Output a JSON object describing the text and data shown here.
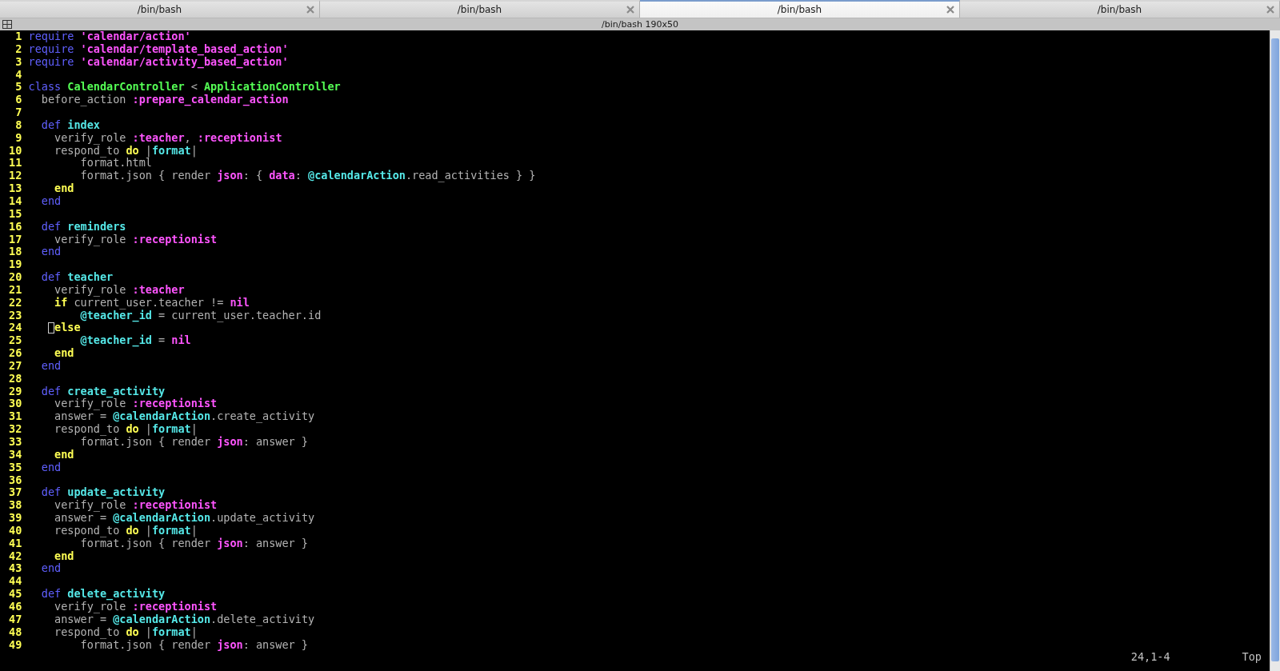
{
  "tabs": [
    {
      "label": "/bin/bash",
      "selected": false
    },
    {
      "label": "/bin/bash",
      "selected": false
    },
    {
      "label": "/bin/bash",
      "selected": true
    },
    {
      "label": "/bin/bash",
      "selected": false
    }
  ],
  "title_bar": {
    "title": "/bin/bash 190x50"
  },
  "editor": {
    "lines": [
      {
        "number": "1",
        "cursor": false,
        "segments": [
          {
            "kind": "keyword",
            "text": "require"
          },
          {
            "kind": "string",
            "text": " 'calendar/action'"
          }
        ]
      },
      {
        "number": "2",
        "cursor": false,
        "segments": [
          {
            "kind": "keyword",
            "text": "require"
          },
          {
            "kind": "string",
            "text": " 'calendar/template_based_action'"
          }
        ]
      },
      {
        "number": "3",
        "cursor": false,
        "segments": [
          {
            "kind": "keyword",
            "text": "require"
          },
          {
            "kind": "string",
            "text": " 'calendar/activity_based_action'"
          }
        ]
      },
      {
        "number": "4",
        "cursor": false
      },
      {
        "number": "5",
        "cursor": false,
        "segments": [
          {
            "kind": "keyword",
            "text": "class"
          },
          {
            "kind": "constant",
            "text": " CalendarController"
          },
          {
            "kind": "plain",
            "text": " < "
          },
          {
            "kind": "constant",
            "text": "ApplicationController"
          }
        ]
      },
      {
        "number": "6",
        "cursor": false,
        "segments": [
          {
            "kind": "plain",
            "text": "  before_action "
          },
          {
            "kind": "symbol",
            "text": ":prepare_calendar_action"
          }
        ]
      },
      {
        "number": "7",
        "cursor": false
      },
      {
        "number": "8",
        "cursor": false,
        "segments": [
          {
            "kind": "keyword",
            "text": "  def"
          },
          {
            "kind": "name",
            "text": " index"
          }
        ]
      },
      {
        "number": "9",
        "cursor": false,
        "segments": [
          {
            "kind": "plain",
            "text": "    verify_role "
          },
          {
            "kind": "symbol",
            "text": ":teacher"
          },
          {
            "kind": "plain",
            "text": ", "
          },
          {
            "kind": "symbol",
            "text": ":receptionist"
          }
        ]
      },
      {
        "number": "10",
        "cursor": false,
        "segments": [
          {
            "kind": "plain",
            "text": "    respond_to "
          },
          {
            "kind": "control",
            "text": "do"
          },
          {
            "kind": "plain",
            "text": " |"
          },
          {
            "kind": "name",
            "text": "format"
          },
          {
            "kind": "plain",
            "text": "|"
          }
        ]
      },
      {
        "number": "11",
        "cursor": false,
        "segments": [
          {
            "kind": "plain",
            "text": "        format.html"
          }
        ]
      },
      {
        "number": "12",
        "cursor": false,
        "segments": [
          {
            "kind": "plain",
            "text": "        format.json { render "
          },
          {
            "kind": "symbol",
            "text": "json"
          },
          {
            "kind": "plain",
            "text": ": { "
          },
          {
            "kind": "symbol",
            "text": "data"
          },
          {
            "kind": "plain",
            "text": ": "
          },
          {
            "kind": "name",
            "text": "@calendarAction"
          },
          {
            "kind": "plain",
            "text": ".read_activities } }"
          }
        ]
      },
      {
        "number": "13",
        "cursor": false,
        "segments": [
          {
            "kind": "control",
            "text": "    end"
          }
        ]
      },
      {
        "number": "14",
        "cursor": false,
        "segments": [
          {
            "kind": "keyword",
            "text": "  end"
          }
        ]
      },
      {
        "number": "15",
        "cursor": false
      },
      {
        "number": "16",
        "cursor": false,
        "segments": [
          {
            "kind": "keyword",
            "text": "  def"
          },
          {
            "kind": "name",
            "text": " reminders"
          }
        ]
      },
      {
        "number": "17",
        "cursor": false,
        "segments": [
          {
            "kind": "plain",
            "text": "    verify_role "
          },
          {
            "kind": "symbol",
            "text": ":receptionist"
          }
        ]
      },
      {
        "number": "18",
        "cursor": false,
        "segments": [
          {
            "kind": "keyword",
            "text": "  end"
          }
        ]
      },
      {
        "number": "19",
        "cursor": false
      },
      {
        "number": "20",
        "cursor": false,
        "segments": [
          {
            "kind": "keyword",
            "text": "  def"
          },
          {
            "kind": "name",
            "text": " teacher"
          }
        ]
      },
      {
        "number": "21",
        "cursor": false,
        "segments": [
          {
            "kind": "plain",
            "text": "    verify_role "
          },
          {
            "kind": "symbol",
            "text": ":teacher"
          }
        ]
      },
      {
        "number": "22",
        "cursor": false,
        "segments": [
          {
            "kind": "control",
            "text": "    if"
          },
          {
            "kind": "plain",
            "text": " current_user.teacher != "
          },
          {
            "kind": "symbol",
            "text": "nil"
          }
        ]
      },
      {
        "number": "23",
        "cursor": false,
        "segments": [
          {
            "kind": "name",
            "text": "        @teacher_id"
          },
          {
            "kind": "plain",
            "text": " = current_user.teacher.id"
          }
        ]
      },
      {
        "number": "24",
        "cursor": true,
        "segments": [
          {
            "kind": "control",
            "text": "    else"
          }
        ]
      },
      {
        "number": "25",
        "cursor": false,
        "segments": [
          {
            "kind": "name",
            "text": "        @teacher_id"
          },
          {
            "kind": "plain",
            "text": " = "
          },
          {
            "kind": "symbol",
            "text": "nil"
          }
        ]
      },
      {
        "number": "26",
        "cursor": false,
        "segments": [
          {
            "kind": "control",
            "text": "    end"
          }
        ]
      },
      {
        "number": "27",
        "cursor": false,
        "segments": [
          {
            "kind": "keyword",
            "text": "  end"
          }
        ]
      },
      {
        "number": "28",
        "cursor": false
      },
      {
        "number": "29",
        "cursor": false,
        "segments": [
          {
            "kind": "keyword",
            "text": "  def"
          },
          {
            "kind": "name",
            "text": " create_activity"
          }
        ]
      },
      {
        "number": "30",
        "cursor": false,
        "segments": [
          {
            "kind": "plain",
            "text": "    verify_role "
          },
          {
            "kind": "symbol",
            "text": ":receptionist"
          }
        ]
      },
      {
        "number": "31",
        "cursor": false,
        "segments": [
          {
            "kind": "plain",
            "text": "    answer = "
          },
          {
            "kind": "name",
            "text": "@calendarAction"
          },
          {
            "kind": "plain",
            "text": ".create_activity"
          }
        ]
      },
      {
        "number": "32",
        "cursor": false,
        "segments": [
          {
            "kind": "plain",
            "text": "    respond_to "
          },
          {
            "kind": "control",
            "text": "do"
          },
          {
            "kind": "plain",
            "text": " |"
          },
          {
            "kind": "name",
            "text": "format"
          },
          {
            "kind": "plain",
            "text": "|"
          }
        ]
      },
      {
        "number": "33",
        "cursor": false,
        "segments": [
          {
            "kind": "plain",
            "text": "        format.json { render "
          },
          {
            "kind": "symbol",
            "text": "json"
          },
          {
            "kind": "plain",
            "text": ": answer }"
          }
        ]
      },
      {
        "number": "34",
        "cursor": false,
        "segments": [
          {
            "kind": "control",
            "text": "    end"
          }
        ]
      },
      {
        "number": "35",
        "cursor": false,
        "segments": [
          {
            "kind": "keyword",
            "text": "  end"
          }
        ]
      },
      {
        "number": "36",
        "cursor": false
      },
      {
        "number": "37",
        "cursor": false,
        "segments": [
          {
            "kind": "keyword",
            "text": "  def"
          },
          {
            "kind": "name",
            "text": " update_activity"
          }
        ]
      },
      {
        "number": "38",
        "cursor": false,
        "segments": [
          {
            "kind": "plain",
            "text": "    verify_role "
          },
          {
            "kind": "symbol",
            "text": ":receptionist"
          }
        ]
      },
      {
        "number": "39",
        "cursor": false,
        "segments": [
          {
            "kind": "plain",
            "text": "    answer = "
          },
          {
            "kind": "name",
            "text": "@calendarAction"
          },
          {
            "kind": "plain",
            "text": ".update_activity"
          }
        ]
      },
      {
        "number": "40",
        "cursor": false,
        "segments": [
          {
            "kind": "plain",
            "text": "    respond_to "
          },
          {
            "kind": "control",
            "text": "do"
          },
          {
            "kind": "plain",
            "text": " |"
          },
          {
            "kind": "name",
            "text": "format"
          },
          {
            "kind": "plain",
            "text": "|"
          }
        ]
      },
      {
        "number": "41",
        "cursor": false,
        "segments": [
          {
            "kind": "plain",
            "text": "        format.json { render "
          },
          {
            "kind": "symbol",
            "text": "json"
          },
          {
            "kind": "plain",
            "text": ": answer }"
          }
        ]
      },
      {
        "number": "42",
        "cursor": false,
        "segments": [
          {
            "kind": "control",
            "text": "    end"
          }
        ]
      },
      {
        "number": "43",
        "cursor": false,
        "segments": [
          {
            "kind": "keyword",
            "text": "  end"
          }
        ]
      },
      {
        "number": "44",
        "cursor": false
      },
      {
        "number": "45",
        "cursor": false,
        "segments": [
          {
            "kind": "keyword",
            "text": "  def"
          },
          {
            "kind": "name",
            "text": " delete_activity"
          }
        ]
      },
      {
        "number": "46",
        "cursor": false,
        "segments": [
          {
            "kind": "plain",
            "text": "    verify_role "
          },
          {
            "kind": "symbol",
            "text": ":receptionist"
          }
        ]
      },
      {
        "number": "47",
        "cursor": false,
        "segments": [
          {
            "kind": "plain",
            "text": "    answer = "
          },
          {
            "kind": "name",
            "text": "@calendarAction"
          },
          {
            "kind": "plain",
            "text": ".delete_activity"
          }
        ]
      },
      {
        "number": "48",
        "cursor": false,
        "segments": [
          {
            "kind": "plain",
            "text": "    respond_to "
          },
          {
            "kind": "control",
            "text": "do"
          },
          {
            "kind": "plain",
            "text": " |"
          },
          {
            "kind": "name",
            "text": "format"
          },
          {
            "kind": "plain",
            "text": "|"
          }
        ]
      },
      {
        "number": "49",
        "cursor": false,
        "segments": [
          {
            "kind": "plain",
            "text": "        format.json { render "
          },
          {
            "kind": "symbol",
            "text": "json"
          },
          {
            "kind": "plain",
            "text": ": answer }"
          }
        ]
      }
    ],
    "ruler": {
      "position": "24,1-4",
      "scroll": "Top"
    }
  }
}
